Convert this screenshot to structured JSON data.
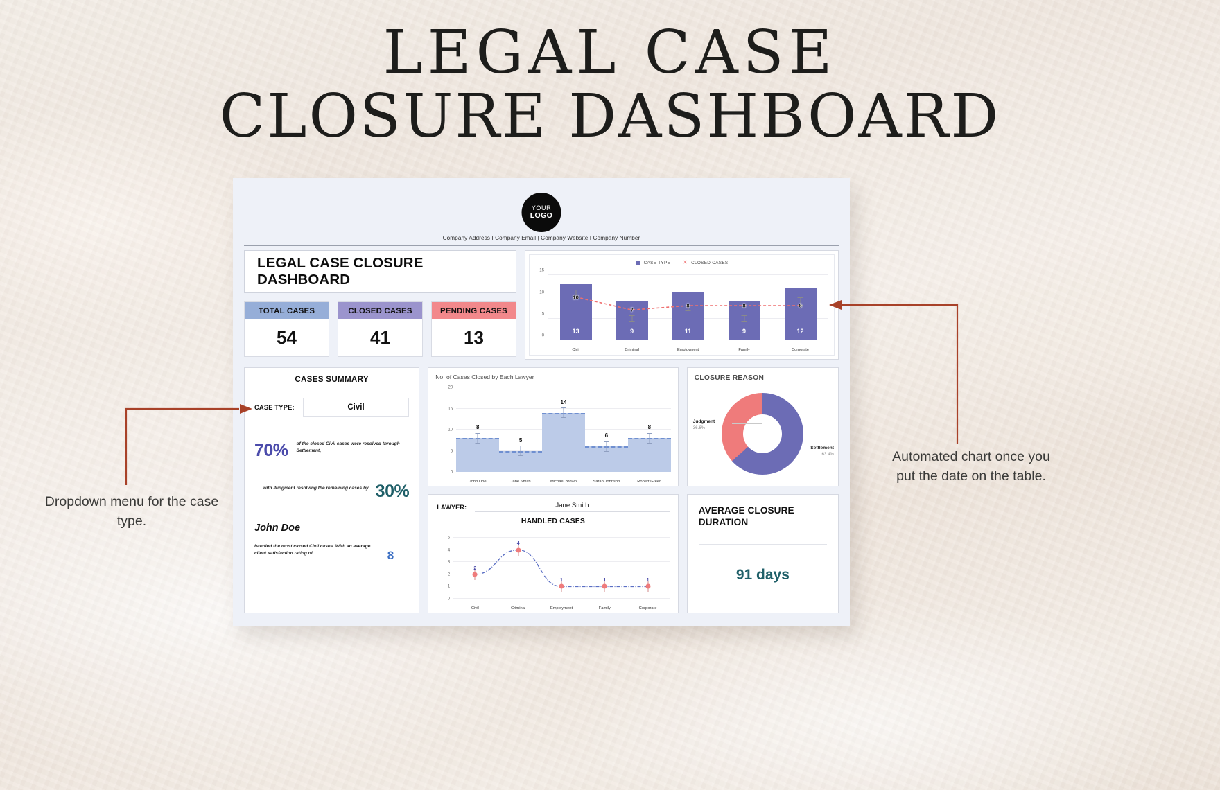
{
  "heading": {
    "line1": "LEGAL CASE",
    "line2": "CLOSURE DASHBOARD"
  },
  "logo": {
    "top": "YOUR",
    "bottom": "LOGO"
  },
  "company_line": "Company Address I Company Email | Company Website I Company Number",
  "dashboard_title": "LEGAL CASE CLOSURE DASHBOARD",
  "kpis": [
    {
      "label": "TOTAL CASES",
      "value": "54",
      "color": "#96aed8"
    },
    {
      "label": "CLOSED CASES",
      "value": "41",
      "color": "#9b94cd"
    },
    {
      "label": "PENDING CASES",
      "value": "13",
      "color": "#f2888b"
    }
  ],
  "summary": {
    "heading": "CASES SUMMARY",
    "case_type_label": "CASE TYPE:",
    "case_type_value": "Civil",
    "settlement_pct": "70%",
    "settlement_text": "of the closed Civil  cases were resolved through Settlement,",
    "judgment_text": "with Judgment resolving the remaining cases by",
    "judgment_pct": "30%",
    "top_lawyer": "John Doe",
    "top_lawyer_text": "handled the most closed Civil cases. With an average client satisfaction rating of",
    "rating": "8"
  },
  "lawyer_panel": {
    "label": "LAWYER:",
    "value": "Jane Smith",
    "subtitle": "HANDLED CASES"
  },
  "closure_reason": {
    "title": "CLOSURE REASON",
    "slices": [
      {
        "name": "Judgment",
        "pct": "36.6%",
        "color": "#ef7b7b"
      },
      {
        "name": "Settlement",
        "pct": "63.4%",
        "color": "#6c6cb5"
      }
    ]
  },
  "average_closure": {
    "title": "AVERAGE CLOSURE DURATION",
    "value": "91 days"
  },
  "annotations": {
    "left": "Dropdown menu for the case type.",
    "right": "Automated chart once you put the date on the table.",
    "color": "#a84128"
  },
  "chart_data": [
    {
      "type": "bar",
      "title": "",
      "categories": [
        "Civil",
        "Criminal",
        "Employment",
        "Family",
        "Corporate"
      ],
      "series": [
        {
          "name": "CASE TYPE",
          "values": [
            13,
            9,
            11,
            9,
            12
          ],
          "color": "#6c6cb5"
        },
        {
          "name": "CLOSED CASES",
          "values": [
            10,
            7,
            8,
            8,
            8
          ],
          "color": "#ef6f6f"
        }
      ],
      "legend": [
        "CASE TYPE",
        "CLOSED CASES"
      ],
      "yticks": [
        0,
        5,
        10,
        15
      ],
      "ylim": [
        0,
        16
      ],
      "grid": true,
      "legend_position": "top-right",
      "error_bars": true
    },
    {
      "type": "area",
      "title": "No. of Cases Closed by Each Lawyer",
      "categories": [
        "John Doe",
        "Jane Smith",
        "Michael Brown",
        "Sarah Johnson",
        "Robert Green"
      ],
      "values": [
        8,
        5,
        14,
        6,
        8
      ],
      "yticks": [
        0,
        5,
        10,
        15,
        20
      ],
      "ylim": [
        0,
        20
      ],
      "color": "#bccbe8",
      "grid": true,
      "error_bars": true
    },
    {
      "type": "line",
      "title": "HANDLED CASES",
      "categories": [
        "Civil",
        "Criminal",
        "Employment",
        "Family",
        "Corporate"
      ],
      "values": [
        2,
        4,
        1,
        1,
        1
      ],
      "yticks": [
        0,
        1,
        2,
        3,
        4,
        5
      ],
      "ylim": [
        0,
        5
      ],
      "color": "#5b6fc4",
      "marker_color": "#ef7b7b",
      "grid": true,
      "error_bars": true
    },
    {
      "type": "pie",
      "title": "CLOSURE REASON",
      "labels": [
        "Judgment",
        "Settlement"
      ],
      "values": [
        36.6,
        63.4
      ],
      "colors": [
        "#ef7b7b",
        "#6c6cb5"
      ],
      "donut": true
    }
  ]
}
